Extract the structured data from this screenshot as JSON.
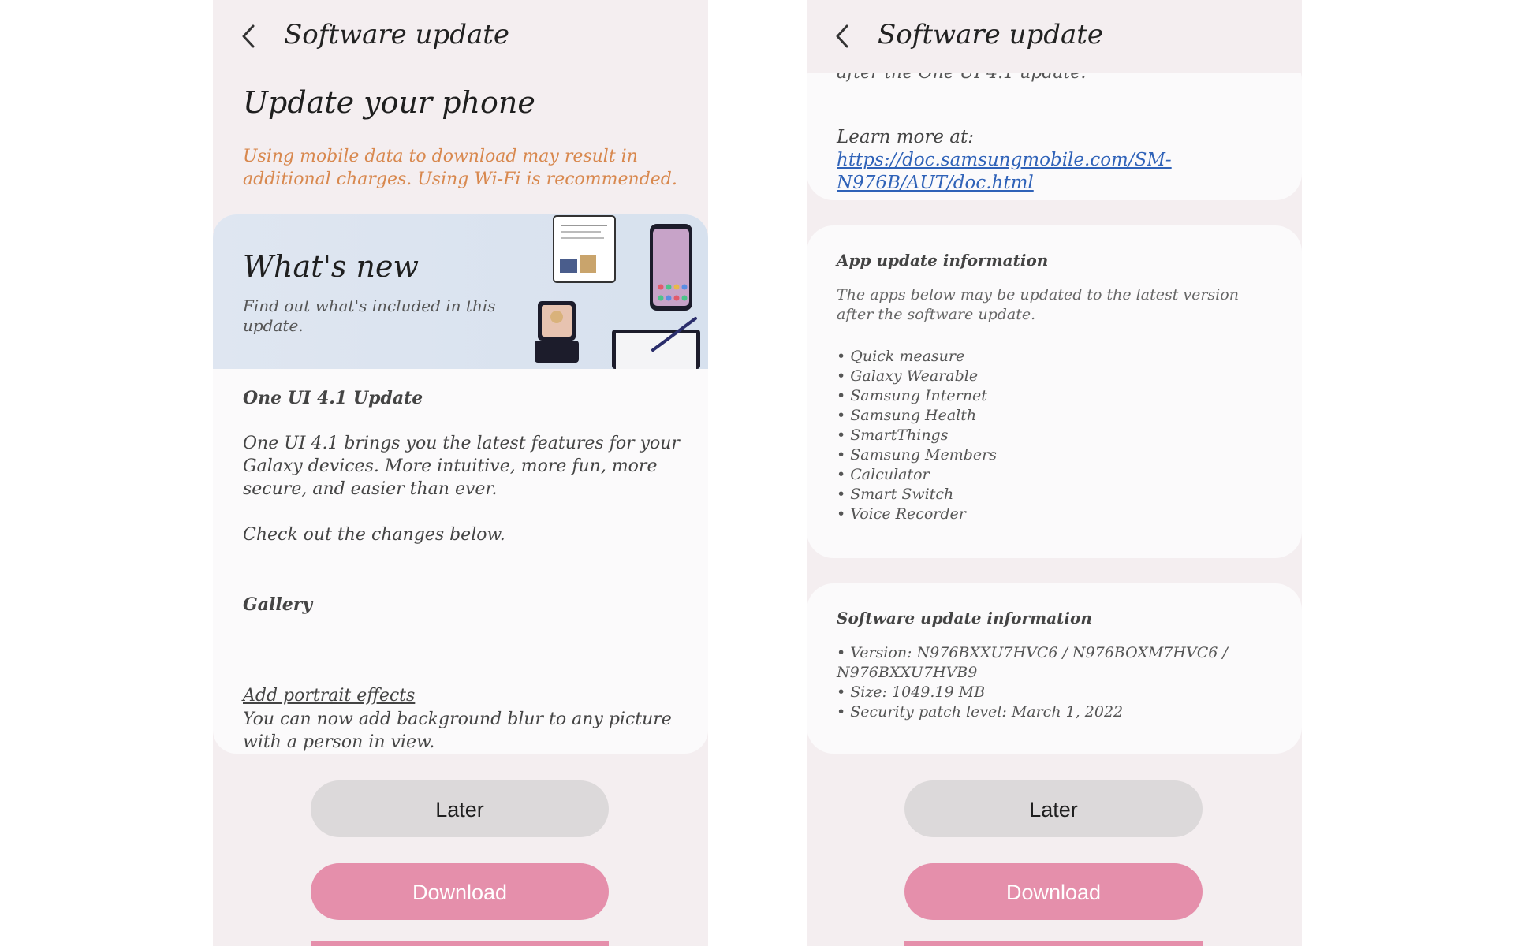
{
  "left": {
    "header_title": "Software update",
    "heading": "Update your phone",
    "warning": "Using mobile data to download may result in additional charges. Using Wi-Fi is recommended.",
    "banner": {
      "title": "What's new",
      "subtitle": "Find out what's included in this update."
    },
    "section_title": "One UI 4.1 Update",
    "intro": "One UI 4.1 brings you the latest features for your Galaxy devices. More intuitive, more fun, more secure, and easier than ever.",
    "check_changes": "Check out the changes below.",
    "gallery_title": "Gallery",
    "feature_link": "Add portrait effects",
    "feature_desc": "You can now add background blur to any picture with a person in view."
  },
  "right": {
    "header_title": "Software update",
    "cut_text": "after the One UI 4.1 update.",
    "learn_label": "Learn more at: ",
    "learn_url": "https://doc.samsungmobile.com/SM-N976B/AUT/doc.html",
    "app_update": {
      "title": "App update information",
      "description": "The apps below may be updated to the latest version after the software update.",
      "apps": [
        "Quick measure",
        "Galaxy Wearable",
        "Samsung Internet",
        "Samsung Health",
        "SmartThings",
        "Samsung Members",
        "Calculator",
        "Smart Switch",
        "Voice Recorder"
      ]
    },
    "sw_update": {
      "title": "Software update information",
      "version": "Version: N976BXXU7HVC6 / N976BOXM7HVC6 / N976BXXU7HVB9",
      "size": "Size: 1049.19 MB",
      "security": "Security patch level: March 1, 2022"
    }
  },
  "buttons": {
    "later": "Later",
    "download": "Download"
  },
  "colors": {
    "accent": "#e58fab",
    "warning": "#d8884e",
    "link": "#2f62b8",
    "background": "#f4eef0"
  },
  "icons": {
    "back": "chevron-left-icon"
  }
}
